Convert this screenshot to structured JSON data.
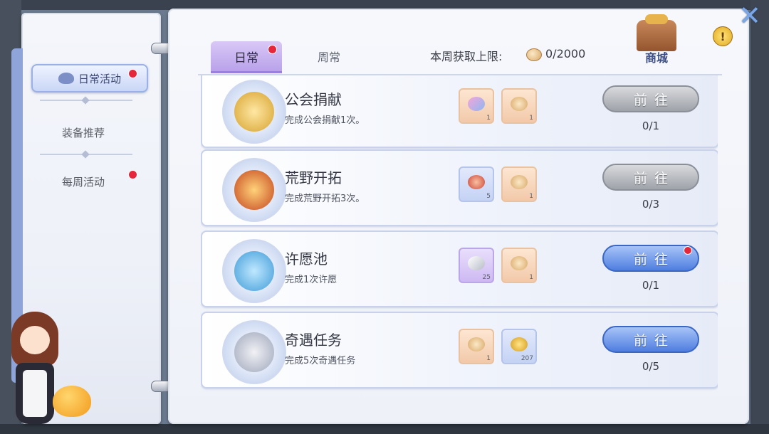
{
  "sidebar": {
    "items": [
      {
        "label": "日常活动",
        "active": true,
        "badge": true
      },
      {
        "label": "装备推荐",
        "active": false,
        "badge": false
      },
      {
        "label": "每周活动",
        "active": false,
        "badge": true
      }
    ]
  },
  "header": {
    "tabs": [
      {
        "label": "日常",
        "active": true,
        "badge": true
      },
      {
        "label": "周常",
        "active": false,
        "badge": false
      }
    ],
    "limit_label": "本周获取上限:",
    "limit_value": "0/2000",
    "shop_label": "商城",
    "alert_glyph": "!",
    "close_glyph": "✕"
  },
  "tasks": [
    {
      "title": "公会捐献",
      "desc": "完成公会捐献1次。",
      "rewards": [
        {
          "style": "peach",
          "qty": "1"
        },
        {
          "style": "peach",
          "qty": "1"
        }
      ],
      "button": "前往",
      "button_state": "gray",
      "progress": "0/1"
    },
    {
      "title": "荒野开拓",
      "desc": "完成荒野开拓3次。",
      "rewards": [
        {
          "style": "blue",
          "qty": "5"
        },
        {
          "style": "peach",
          "qty": "1"
        }
      ],
      "button": "前往",
      "button_state": "gray",
      "progress": "0/3"
    },
    {
      "title": "许愿池",
      "desc": "完成1次许愿",
      "rewards": [
        {
          "style": "purple",
          "qty": "25"
        },
        {
          "style": "peach",
          "qty": "1"
        }
      ],
      "button": "前往",
      "button_state": "blue",
      "button_badge": true,
      "progress": "0/1"
    },
    {
      "title": "奇遇任务",
      "desc": "完成5次奇遇任务",
      "rewards": [
        {
          "style": "peach",
          "qty": "1"
        },
        {
          "style": "blue",
          "qty": "207"
        }
      ],
      "button": "前往",
      "button_state": "blue",
      "progress": "0/5"
    }
  ],
  "colors": {
    "accent_blue": "#4f7ee0",
    "tab_purple": "#b9a2ea",
    "badge_red": "#e6263a",
    "button_gray": "#9ea2a9"
  }
}
